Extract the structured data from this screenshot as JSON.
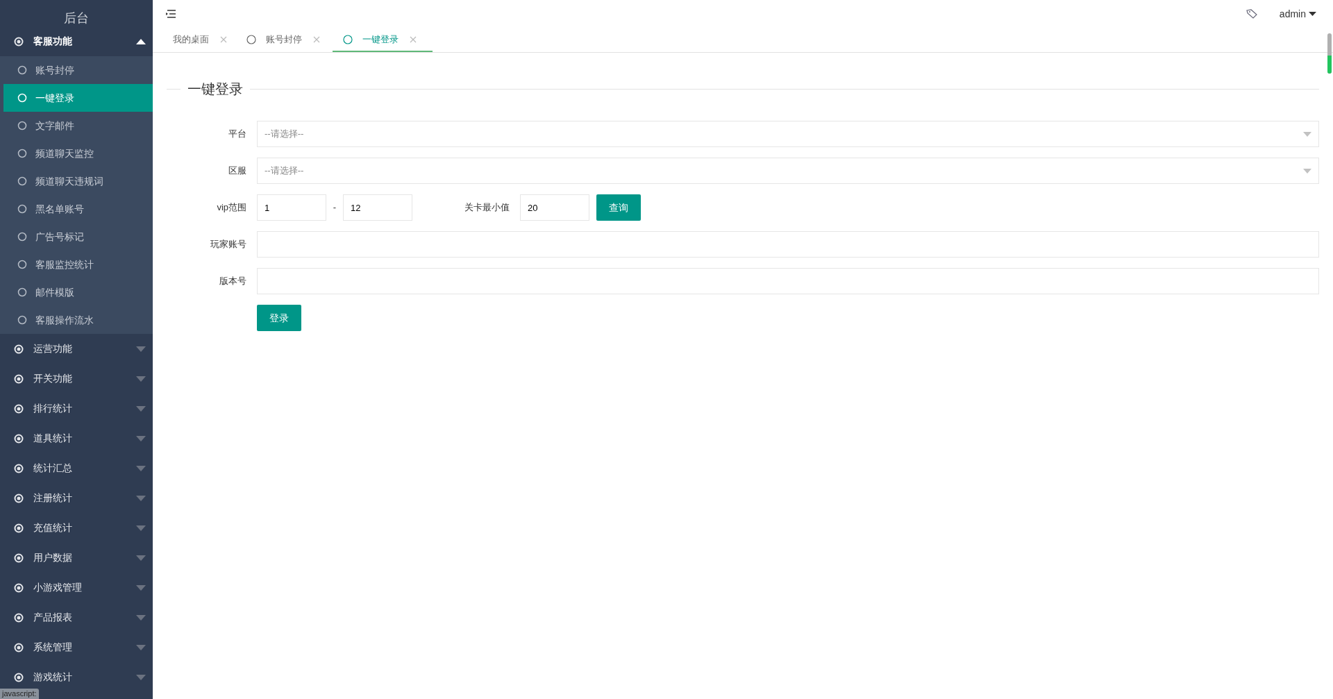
{
  "sidebar": {
    "title": "后台",
    "groups": [
      {
        "label": "客服功能",
        "expanded": true,
        "children": [
          {
            "label": "账号封停",
            "selected": false
          },
          {
            "label": "一键登录",
            "selected": true
          },
          {
            "label": "文字邮件",
            "selected": false
          },
          {
            "label": "频道聊天监控",
            "selected": false
          },
          {
            "label": "频道聊天违规词",
            "selected": false
          },
          {
            "label": "黑名单账号",
            "selected": false
          },
          {
            "label": "广告号标记",
            "selected": false
          },
          {
            "label": "客服监控统计",
            "selected": false
          },
          {
            "label": "邮件模版",
            "selected": false
          },
          {
            "label": "客服操作流水",
            "selected": false
          }
        ]
      },
      {
        "label": "运营功能",
        "expanded": false
      },
      {
        "label": "开关功能",
        "expanded": false
      },
      {
        "label": "排行统计",
        "expanded": false
      },
      {
        "label": "道具统计",
        "expanded": false
      },
      {
        "label": "统计汇总",
        "expanded": false
      },
      {
        "label": "注册统计",
        "expanded": false
      },
      {
        "label": "充值统计",
        "expanded": false
      },
      {
        "label": "用户数据",
        "expanded": false
      },
      {
        "label": "小游戏管理",
        "expanded": false
      },
      {
        "label": "产品报表",
        "expanded": false
      },
      {
        "label": "系统管理",
        "expanded": false
      },
      {
        "label": "游戏统计",
        "expanded": false
      }
    ]
  },
  "header": {
    "user": "admin"
  },
  "tabs": [
    {
      "label": "我的桌面",
      "kind": "home",
      "selected": false
    },
    {
      "label": "账号封停",
      "kind": "page",
      "selected": false
    },
    {
      "label": "一键登录",
      "kind": "page",
      "selected": true
    }
  ],
  "form": {
    "legend": "一键登录",
    "platform": {
      "label": "平台",
      "placeholder": "--请选择--"
    },
    "server": {
      "label": "区服",
      "placeholder": "--请选择--"
    },
    "vip": {
      "label": "vip范围",
      "from": "1",
      "separator": "-",
      "to": "12"
    },
    "level_min": {
      "label": "关卡最小值",
      "value": "20"
    },
    "query_button": "查询",
    "account": {
      "label": "玩家账号"
    },
    "version": {
      "label": "版本号"
    },
    "login_button": "登录"
  },
  "status_tip": "javascript:"
}
